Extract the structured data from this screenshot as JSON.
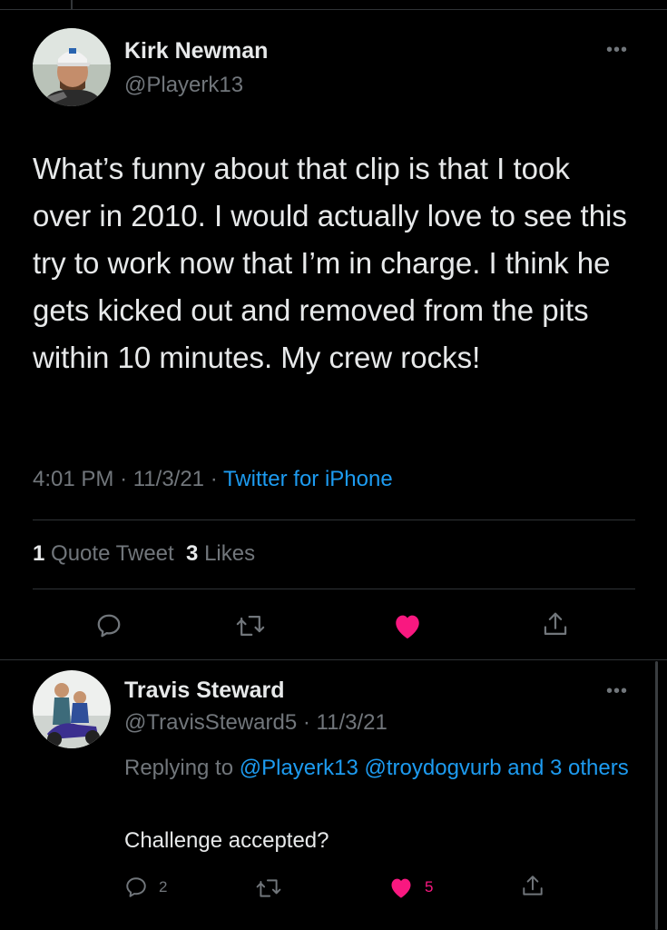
{
  "main_tweet": {
    "author_name": "Kirk Newman",
    "author_handle": "@Playerk13",
    "more_label": "•••",
    "text": "What’s funny about that clip is that I took over in 2010. I would actually love to see this try to work now that I’m in charge. I think he gets kicked out and removed from the pits within 10 minutes. My crew rocks!",
    "time": "4:01 PM",
    "date": "11/3/21",
    "source": "Twitter for iPhone",
    "quote_count": "1",
    "quote_label": "Quote Tweet",
    "like_count": "3",
    "like_label": "Likes",
    "liked": true
  },
  "reply_tweet": {
    "author_name": "Travis Steward",
    "author_handle": "@TravisSteward5",
    "date": "11/3/21",
    "more_label": "•••",
    "replying_prefix": "Replying to",
    "mention_1": "@Playerk13",
    "mention_2": "@troydogvurb",
    "mention_more": "and 3 others",
    "text": "Challenge accepted?",
    "reply_count": "2",
    "like_count": "5",
    "liked": true
  },
  "separators": {
    "dot": "·"
  },
  "icons": {
    "reply": "reply-icon",
    "retweet": "retweet-icon",
    "like": "heart-icon",
    "share": "share-icon"
  },
  "colors": {
    "background": "#000000",
    "text": "#e7e9ea",
    "secondary": "#71767b",
    "accent": "#1d9bf0",
    "like": "#f91880"
  }
}
